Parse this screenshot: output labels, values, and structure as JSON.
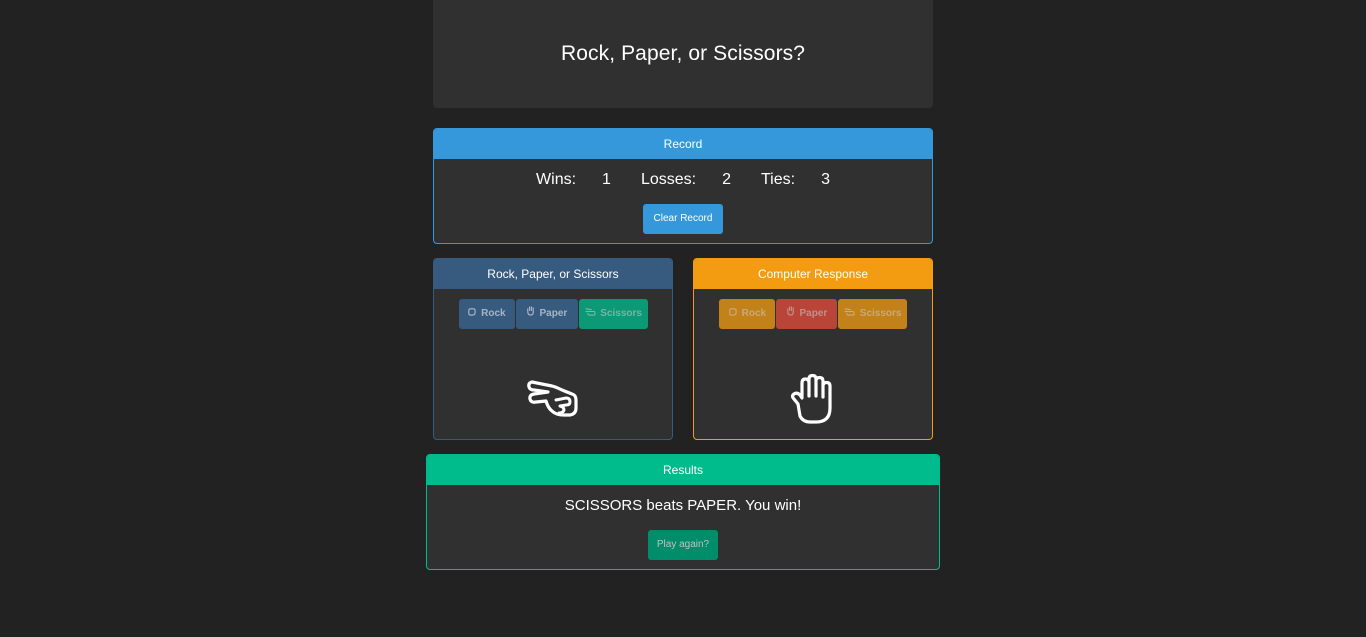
{
  "title": "Rock, Paper, or Scissors?",
  "record": {
    "header": "Record",
    "wins_label": "Wins:",
    "wins": "1",
    "losses_label": "Losses:",
    "losses": "2",
    "ties_label": "Ties:",
    "ties": "3",
    "clear_label": "Clear Record"
  },
  "player": {
    "header": "Rock, Paper, or Scissors",
    "buttons": [
      {
        "label": "Rock",
        "icon": "hand-rock-icon"
      },
      {
        "label": "Paper",
        "icon": "hand-paper-icon"
      },
      {
        "label": "Scissors",
        "icon": "hand-scissors-icon",
        "selected": true
      }
    ],
    "choice_icon": "hand-scissors-icon"
  },
  "computer": {
    "header": "Computer Response",
    "buttons": [
      {
        "label": "Rock",
        "icon": "hand-rock-icon"
      },
      {
        "label": "Paper",
        "icon": "hand-paper-icon",
        "selected": true
      },
      {
        "label": "Scissors",
        "icon": "hand-scissors-icon"
      }
    ],
    "choice_icon": "hand-paper-icon"
  },
  "results": {
    "header": "Results",
    "message": "SCISSORS beats PAPER. You win!",
    "play_again_label": "Play again?"
  },
  "colors": {
    "background": "#222222",
    "panel": "#303030",
    "record_accent": "#3498db",
    "player_accent": "#375a7f",
    "computer_accent": "#f39c12",
    "results_accent": "#00bc8c",
    "danger": "#e74c3c"
  }
}
